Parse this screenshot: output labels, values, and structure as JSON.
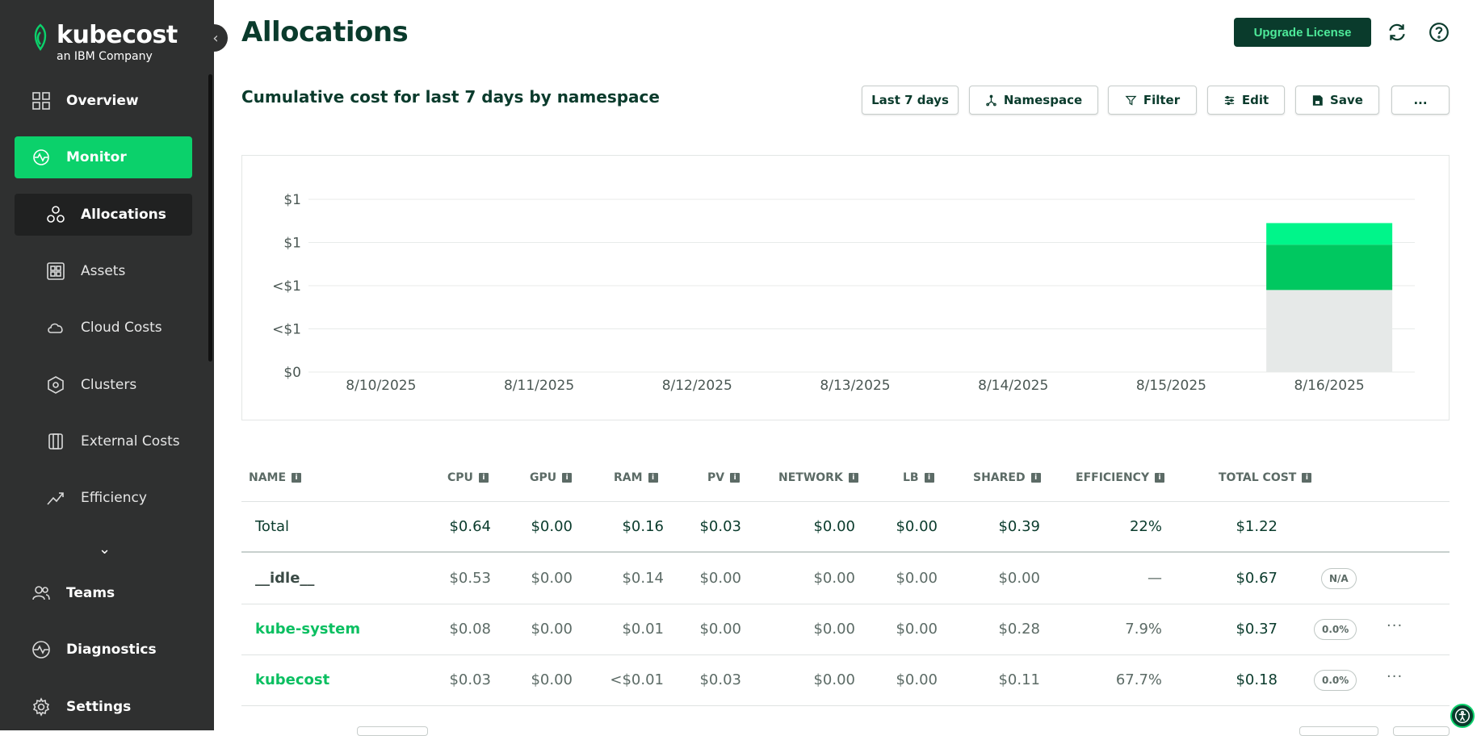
{
  "brand": {
    "name": "kubecost",
    "tagline": "an IBM Company"
  },
  "sidebar": {
    "items": [
      {
        "label": "Overview",
        "icon": "grid-icon"
      },
      {
        "label": "Monitor",
        "icon": "monitor-icon"
      },
      {
        "label": "Allocations",
        "icon": "allocations-icon"
      },
      {
        "label": "Assets",
        "icon": "assets-icon"
      },
      {
        "label": "Cloud Costs",
        "icon": "cloud-icon"
      },
      {
        "label": "Clusters",
        "icon": "clusters-icon"
      },
      {
        "label": "External Costs",
        "icon": "external-costs-icon"
      },
      {
        "label": "Efficiency",
        "icon": "efficiency-icon"
      },
      {
        "label": "Teams",
        "icon": "teams-icon"
      },
      {
        "label": "Diagnostics",
        "icon": "diagnostics-icon"
      },
      {
        "label": "Settings",
        "icon": "settings-icon"
      }
    ]
  },
  "header": {
    "title": "Allocations",
    "upgrade_label": "Upgrade License"
  },
  "toolbar": {
    "subtitle": "Cumulative cost for last 7 days by namespace",
    "range_label": "Last 7 days",
    "aggregate_label": "Namespace",
    "filter_label": "Filter",
    "edit_label": "Edit",
    "save_label": "Save",
    "more_label": "..."
  },
  "colors": {
    "brand_dark": "#0a3b2c",
    "brand_green": "#0bd16b",
    "series_light": "#00f58a",
    "series_mid": "#00c860",
    "series_idle": "#e6e9e8"
  },
  "chart_data": {
    "type": "bar",
    "stacked": true,
    "categories": [
      "8/10/2025",
      "8/11/2025",
      "8/12/2025",
      "8/13/2025",
      "8/14/2025",
      "8/15/2025",
      "8/16/2025"
    ],
    "y_tick_labels": [
      "$0",
      "<$1",
      "<$1",
      "$1",
      "$1"
    ],
    "ylim": [
      0,
      1.6
    ],
    "series": [
      {
        "values": [
          0,
          0,
          0,
          0,
          0,
          0,
          0.76
        ],
        "color": "#e6e9e8"
      },
      {
        "values": [
          0,
          0,
          0,
          0,
          0,
          0,
          0.42
        ],
        "color": "#00c860"
      },
      {
        "values": [
          0,
          0,
          0,
          0,
          0,
          0,
          0.2
        ],
        "color": "#00f58a"
      }
    ],
    "grid": true
  },
  "table": {
    "headers": [
      "NAME",
      "CPU",
      "GPU",
      "RAM",
      "PV",
      "NETWORK",
      "LB",
      "SHARED",
      "EFFICIENCY",
      "TOTAL COST"
    ],
    "total": {
      "name": "Total",
      "cpu": "$0.64",
      "gpu": "$0.00",
      "ram": "$0.16",
      "pv": "$0.03",
      "network": "$0.00",
      "lb": "$0.00",
      "shared": "$0.39",
      "efficiency": "22%",
      "total": "$1.22"
    },
    "rows": [
      {
        "name": "__idle__",
        "cpu": "$0.53",
        "gpu": "$0.00",
        "ram": "$0.14",
        "pv": "$0.00",
        "network": "$0.00",
        "lb": "$0.00",
        "shared": "$0.00",
        "efficiency": "—",
        "total": "$0.67",
        "badge": "N/A"
      },
      {
        "name": "kube-system",
        "cpu": "$0.08",
        "gpu": "$0.00",
        "ram": "$0.01",
        "pv": "$0.00",
        "network": "$0.00",
        "lb": "$0.00",
        "shared": "$0.28",
        "efficiency": "7.9%",
        "total": "$0.37",
        "badge": "0.0%"
      },
      {
        "name": "kubecost",
        "cpu": "$0.03",
        "gpu": "$0.00",
        "ram": "<$0.01",
        "pv": "$0.03",
        "network": "$0.00",
        "lb": "$0.00",
        "shared": "$0.11",
        "efficiency": "67.7%",
        "total": "$0.18",
        "badge": "0.0%"
      }
    ],
    "row_more": "···"
  }
}
